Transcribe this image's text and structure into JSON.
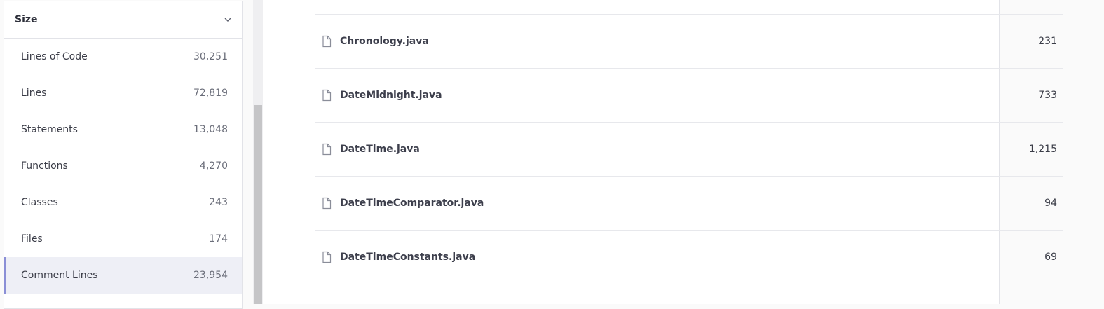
{
  "facet": {
    "title": "Size",
    "items": [
      {
        "label": "Lines of Code",
        "count": "30,251"
      },
      {
        "label": "Lines",
        "count": "72,819"
      },
      {
        "label": "Statements",
        "count": "13,048"
      },
      {
        "label": "Functions",
        "count": "4,270"
      },
      {
        "label": "Classes",
        "count": "243"
      },
      {
        "label": "Files",
        "count": "174"
      },
      {
        "label": "Comment Lines",
        "count": "23,954",
        "selected": true
      }
    ]
  },
  "files": [
    {
      "name": "Chronology.java",
      "value": "231"
    },
    {
      "name": "DateMidnight.java",
      "value": "733"
    },
    {
      "name": "DateTime.java",
      "value": "1,215"
    },
    {
      "name": "DateTimeComparator.java",
      "value": "94"
    },
    {
      "name": "DateTimeConstants.java",
      "value": "69"
    }
  ],
  "icons": {
    "file": "file-icon",
    "collapse": "chevron-down-icon"
  },
  "colors": {
    "selected_bar": "#8b8fd6",
    "selected_bg": "#eeeff6"
  }
}
